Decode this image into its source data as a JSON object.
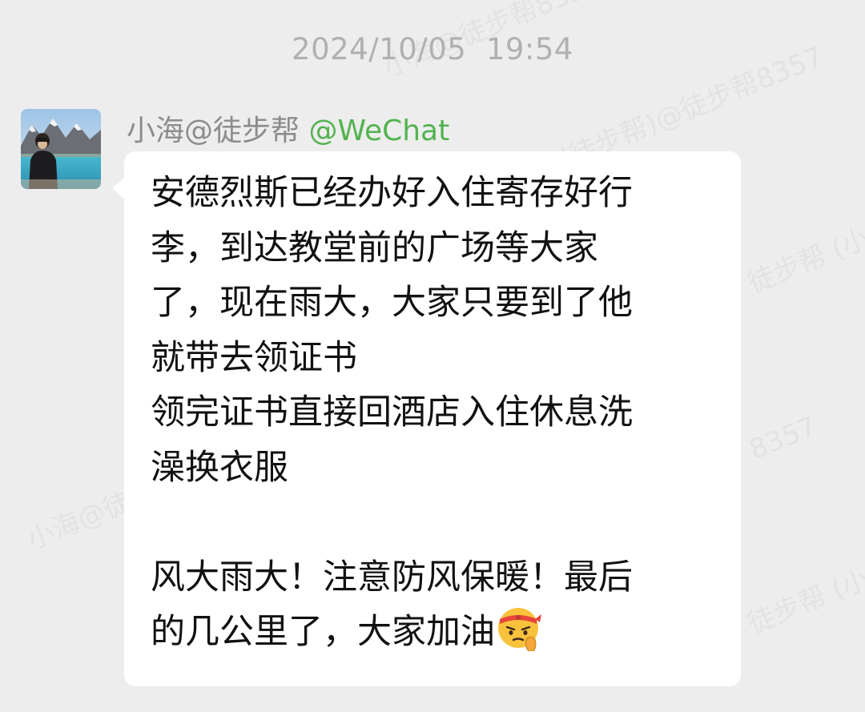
{
  "chat": {
    "timestamp": "2024/10/05  19:54",
    "message": {
      "sender_name": "小海@徒步帮",
      "source_tag": "@WeChat",
      "lines": [
        "安德烈斯已经办好入住寄存好行",
        "李，到达教堂前的广场等大家",
        "了，现在雨大，大家只要到了他",
        "就带去领证书",
        "领完证书直接回酒店入住休息洗",
        "澡换衣服",
        "",
        "风大雨大！注意防风保暖！最后",
        "的几公里了，大家加油"
      ],
      "trailing_emoji": "saluting-face-headband-emoji"
    }
  },
  "watermark": {
    "texts": [
      "小海@徒步帮8357",
      "(徒步帮)@徒步帮8357",
      "徒步帮 (小海",
      "8357",
      "小海@徒步",
      "徒步帮 (小海"
    ]
  },
  "colors": {
    "background": "#ededed",
    "bubble": "#ffffff",
    "timestamp": "#b0b0b0",
    "sender_name": "#8c8c8c",
    "source_tag": "#52b34f",
    "message_text": "#111111"
  }
}
